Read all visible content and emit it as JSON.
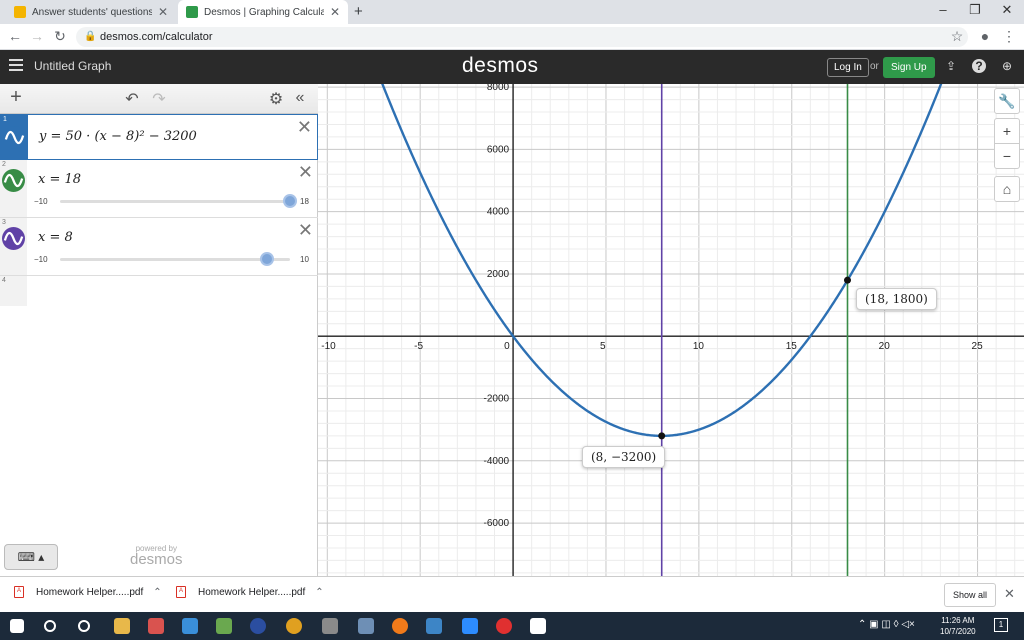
{
  "browser": {
    "tabs": [
      {
        "title": "Answer students' questions and e",
        "active": false
      },
      {
        "title": "Desmos | Graphing Calculator",
        "active": true
      }
    ],
    "new_tab": "+",
    "url": "desmos.com/calculator"
  },
  "header": {
    "graph_title": "Untitled Graph",
    "logo": "desmos",
    "login": "Log In",
    "or": "or",
    "signup": "Sign Up"
  },
  "expressions": [
    {
      "num": "1",
      "latex": "y = 50 · (x − 8)² − 3200",
      "color": "#2d70b3"
    },
    {
      "num": "2",
      "latex": "x = 18",
      "color": "#388c46",
      "slider": {
        "min": "−10",
        "max": "18",
        "value": 18
      }
    },
    {
      "num": "3",
      "latex": "x = 8",
      "color": "#6042a6",
      "slider": {
        "min": "−10",
        "max": "10",
        "value": 8
      }
    },
    {
      "num": "4"
    }
  ],
  "powered_by": {
    "line1": "powered by",
    "line2": "desmos"
  },
  "graph": {
    "x_ticks": [
      "-10",
      "-5",
      "0",
      "5",
      "10",
      "15",
      "20",
      "25"
    ],
    "y_ticks": [
      "8000",
      "6000",
      "4000",
      "2000",
      "-2000",
      "-4000",
      "-6000"
    ],
    "curve_color": "#2d70b3",
    "points": [
      {
        "label": "(8, −3200)",
        "x": 8,
        "y": -3200
      },
      {
        "label": "(18, 1800)",
        "x": 18,
        "y": 1800
      }
    ]
  },
  "chart_data": {
    "type": "line",
    "series": [
      {
        "equation": "y = 50(x − 8)^2 − 3200",
        "color": "#2d70b3"
      },
      {
        "equation": "x = 18",
        "color": "#388c46"
      },
      {
        "equation": "x = 8",
        "color": "#6042a6"
      }
    ],
    "xlim": [
      -10.5,
      27.5
    ],
    "ylim": [
      -7700,
      8100
    ],
    "x_tick_step": 5,
    "y_tick_step": 2000,
    "grid": true
  },
  "downloads": {
    "items": [
      "Homework Helper.....pdf",
      "Homework Helper.....pdf"
    ],
    "show_all": "Show all"
  },
  "taskbar": {
    "time": "11:26 AM",
    "date": "10/7/2020"
  }
}
